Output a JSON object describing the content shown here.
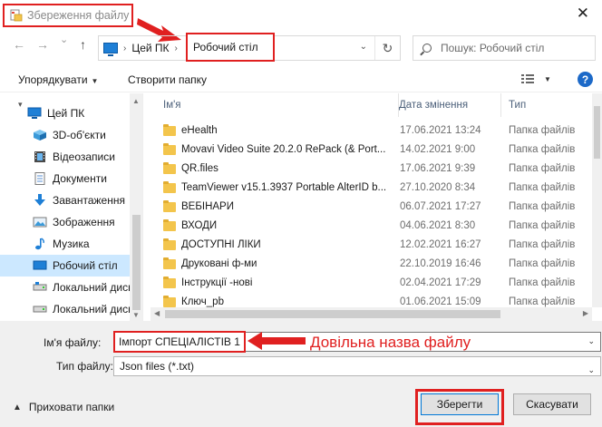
{
  "window": {
    "title": "Збереження файлу",
    "close_glyph": "✕"
  },
  "nav": {
    "back_glyph": "←",
    "forward_glyph": "→",
    "recent_glyph": "⌄",
    "up_glyph": "↑",
    "breadcrumb": [
      "Цей ПК",
      "Робочий стіл"
    ],
    "separator_glyph": "›",
    "refresh_glyph": "↻",
    "search_placeholder": "Пошук: Робочий стіл"
  },
  "toolbar": {
    "organize_label": "Упорядкувати",
    "new_folder_label": "Створити папку",
    "help_glyph": "?"
  },
  "sidebar": {
    "items": [
      {
        "label": "Цей ПК",
        "icon": "pc-icon"
      },
      {
        "label": "3D-об'єкти",
        "icon": "cube-3d-icon"
      },
      {
        "label": "Відеозаписи",
        "icon": "film-icon"
      },
      {
        "label": "Документи",
        "icon": "document-icon"
      },
      {
        "label": "Завантаження",
        "icon": "download-arrow-icon"
      },
      {
        "label": "Зображення",
        "icon": "picture-icon"
      },
      {
        "label": "Музика",
        "icon": "music-note-icon"
      },
      {
        "label": "Робочий стіл",
        "icon": "desktop-icon",
        "selected": true
      },
      {
        "label": "Локальний диск",
        "icon": "drive-icon"
      },
      {
        "label": "Локальний диск",
        "icon": "drive-icon"
      }
    ]
  },
  "filelist": {
    "columns": [
      "Ім'я",
      "Дата змінення",
      "Тип"
    ],
    "rows": [
      {
        "name": "eHealth",
        "date": "17.06.2021 13:24",
        "type": "Папка файлів"
      },
      {
        "name": "Movavi Video Suite 20.2.0 RePack (& Port...",
        "date": "14.02.2021 9:00",
        "type": "Папка файлів"
      },
      {
        "name": "QR.files",
        "date": "17.06.2021 9:39",
        "type": "Папка файлів"
      },
      {
        "name": "TeamViewer v15.1.3937 Portable AlterID b...",
        "date": "27.10.2020 8:34",
        "type": "Папка файлів"
      },
      {
        "name": "ВЕБІНАРИ",
        "date": "06.07.2021 17:27",
        "type": "Папка файлів"
      },
      {
        "name": "ВХОДИ",
        "date": "04.06.2021 8:30",
        "type": "Папка файлів"
      },
      {
        "name": "ДОСТУПНІ ЛІКИ",
        "date": "12.02.2021 16:27",
        "type": "Папка файлів"
      },
      {
        "name": "Друковані ф-ми",
        "date": "22.10.2019 16:46",
        "type": "Папка файлів"
      },
      {
        "name": "Інструкції -нові",
        "date": "02.04.2021 17:29",
        "type": "Папка файлів"
      },
      {
        "name": "Ключ_pb",
        "date": "01.06.2021 15:09",
        "type": "Папка файлів"
      }
    ]
  },
  "form": {
    "filename_label": "Ім'я файлу:",
    "filename_value": "Імпорт СПЕЦІАЛІСТІВ 1",
    "annotation": "Довільна назва файлу",
    "filetype_label": "Тип файлу:",
    "filetype_value": "Json files (*.txt)"
  },
  "footer": {
    "hide_folders_label": "Приховати папки",
    "save_label": "Зберегти",
    "cancel_label": "Скасувати"
  },
  "colors": {
    "annotation_red": "#e02020",
    "selection_blue": "#cce8ff",
    "folder_yellow": "#f3c54c"
  }
}
